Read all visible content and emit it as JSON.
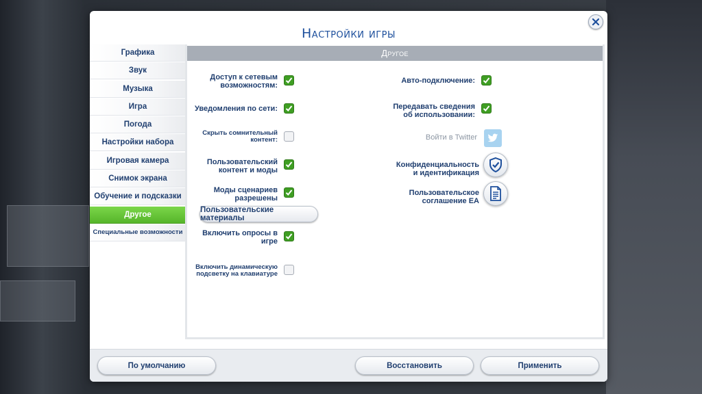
{
  "dialog": {
    "title": "Настройки игры"
  },
  "sidebar": {
    "items": [
      {
        "label": "Графика"
      },
      {
        "label": "Звук"
      },
      {
        "label": "Музыка"
      },
      {
        "label": "Игра"
      },
      {
        "label": "Погода"
      },
      {
        "label": "Настройки набора"
      },
      {
        "label": "Игровая камера"
      },
      {
        "label": "Снимок экрана"
      },
      {
        "label": "Обучение и подсказки"
      },
      {
        "label": "Другое",
        "active": true
      },
      {
        "label": "Специальные возможности"
      }
    ]
  },
  "panel": {
    "header": "Другое",
    "left_options": [
      {
        "label_line1": "Доступ к сетевым",
        "label_line2": "возможностям:",
        "checked": true
      },
      {
        "label_line1": "Уведомления по сети:",
        "checked": true
      },
      {
        "label_line1": "Скрыть сомнительный",
        "label_line2": "контент:",
        "checked": false
      },
      {
        "label_line1": "Пользовательский",
        "label_line2": "контент и моды",
        "checked": true
      },
      {
        "label_line1": "Моды сценариев",
        "label_line2": "разрешены",
        "checked": true
      },
      {
        "label_line1": "Включить опросы в",
        "label_line2": "игре",
        "checked": true
      },
      {
        "label_line1": "Включить динамическую",
        "label_line2": "подсветку на клавиатуре",
        "checked": false
      }
    ],
    "custom_content_button": "Пользовательские материалы",
    "right_options": {
      "auto_connect": {
        "label": "Авто-подключение:",
        "checked": true
      },
      "share_usage": {
        "label_line1": "Передавать сведения",
        "label_line2": "об использовании:",
        "checked": true
      },
      "twitter": {
        "label": "Войти в Twitter"
      },
      "privacy": {
        "label_line1": "Конфиденциальность",
        "label_line2": "и идентификация"
      },
      "ea_agreement": {
        "label_line1": "Пользовательское",
        "label_line2": "соглашение EA"
      }
    }
  },
  "footer": {
    "default_button": "По умолчанию",
    "restore_button": "Восстановить",
    "apply_button": "Применить"
  },
  "colors": {
    "accent_blue": "#1d4f9c",
    "active_green": "#56b52a",
    "check_green": "#3f9e23",
    "header_gray": "#a7adb6"
  },
  "icons": {
    "close": "close-icon",
    "check": "checkmark-icon",
    "twitter": "twitter-bird-icon",
    "privacy": "shield-check-icon",
    "agreement": "document-icon"
  }
}
